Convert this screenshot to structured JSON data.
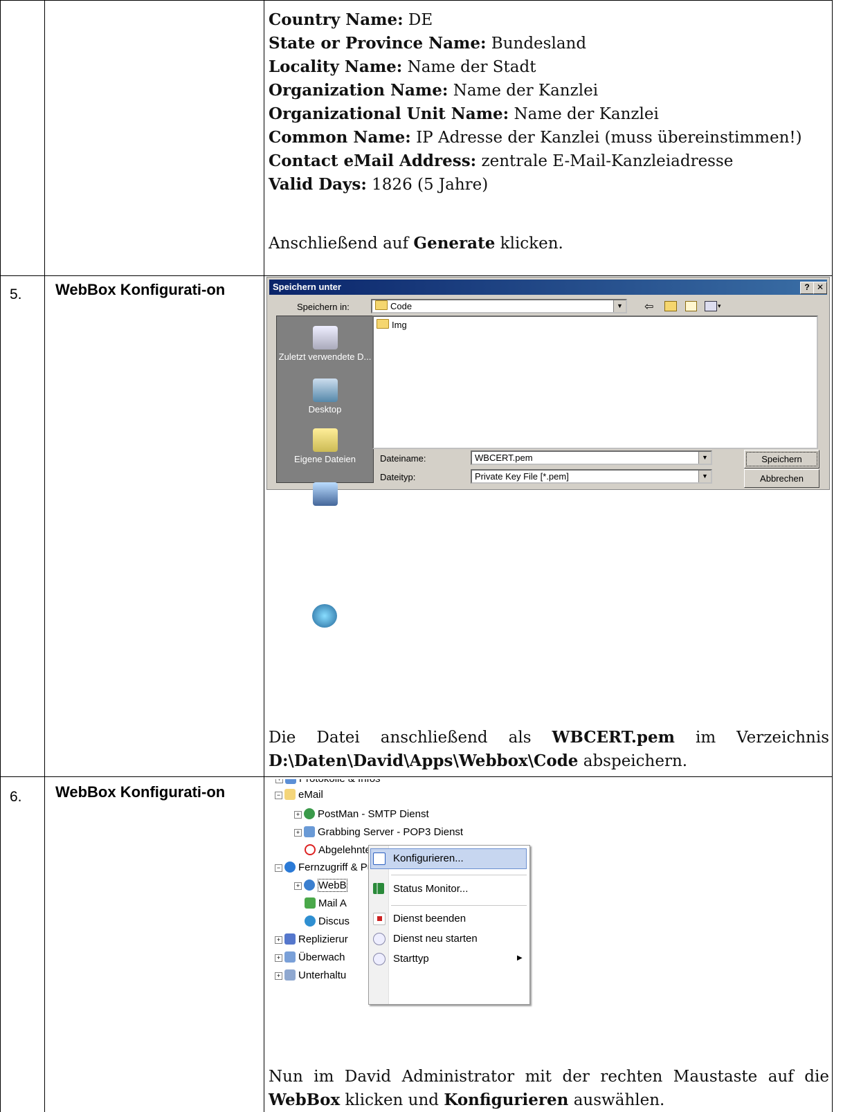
{
  "row4": {
    "fields": [
      {
        "label": "Country Name:",
        "value": " DE"
      },
      {
        "label": "State or Province Name:",
        "value": " Bundesland"
      },
      {
        "label": "Locality Name:",
        "value": " Name der Stadt"
      },
      {
        "label": "Organization Name:",
        "value": " Name der Kanzlei"
      },
      {
        "label": "Organizational Unit Name:",
        "value": " Name der Kanzlei"
      },
      {
        "label": "Common Name:",
        "value": " IP Adresse der Kanzlei (muss übereinstimmen!)"
      },
      {
        "label": "Contact eMail Address:",
        "value": " zentrale E-Mail-Kanzleiadresse"
      },
      {
        "label": "Valid Days:",
        "value": " 1826 (5 Jahre)"
      }
    ],
    "instruction_pre": "Anschließend auf ",
    "instruction_bold": "Generate",
    "instruction_post": " klicken."
  },
  "row5": {
    "number": "5.",
    "section": "WebBox Konfigurati-on",
    "dialog": {
      "title": "Speichern unter",
      "help_btn": "?",
      "close_btn": "✕",
      "save_in_label": "Speichern in:",
      "save_in_value": "Code",
      "file_items": [
        "Img"
      ],
      "places": [
        "Zuletzt verwendete D...",
        "Desktop",
        "Eigene Dateien",
        "Arbeitsplatz",
        "Netzwerkumgeb ung"
      ],
      "filename_label": "Dateiname:",
      "filename_value": "WBCERT.pem",
      "filetype_label": "Dateityp:",
      "filetype_value": "Private Key File [*.pem]",
      "save_button": "Speichern",
      "cancel_button": "Abbrechen",
      "toolbar_icons": [
        "back-arrow-icon",
        "up-folder-icon",
        "new-folder-icon",
        "view-menu-icon"
      ]
    },
    "text_pre": "Die Datei anschließend als ",
    "text_bold1": "WBCERT.pem",
    "text_mid": " im Verzeichnis ",
    "text_bold2": "D:\\Daten\\David\\Apps\\Webbox\\Code",
    "text_post": " abspeichern."
  },
  "row6": {
    "number": "6.",
    "section": "WebBox Konfigurati-on",
    "tree": {
      "items": [
        "Protokolle & Infos",
        "eMail",
        "PostMan -  SMTP Dienst",
        "Grabbing Server -  POP3 Dienst",
        "Abgelehnte Adressen",
        "Fernzugriff & Publizierung",
        "WebB",
        "Mail A",
        "Discus",
        "Replizierur",
        "Überwach",
        "Unterhaltu"
      ]
    },
    "context_menu": {
      "items": [
        "Konfigurieren...",
        "Status Monitor...",
        "Dienst beenden",
        "Dienst neu starten",
        "Starttyp"
      ]
    },
    "text_pre": "Nun im David Administrator mit der rechten Maustaste auf die ",
    "text_bold1": "WebBox",
    "text_mid": " klicken und ",
    "text_bold2": "Konfigurieren",
    "text_post": " auswählen."
  },
  "colors": {
    "titlebar_start": "#0a246a",
    "titlebar_end": "#3a6ea5",
    "dialog_bg": "#d4d0c8",
    "menu_highlight": "#c7d6f0"
  }
}
